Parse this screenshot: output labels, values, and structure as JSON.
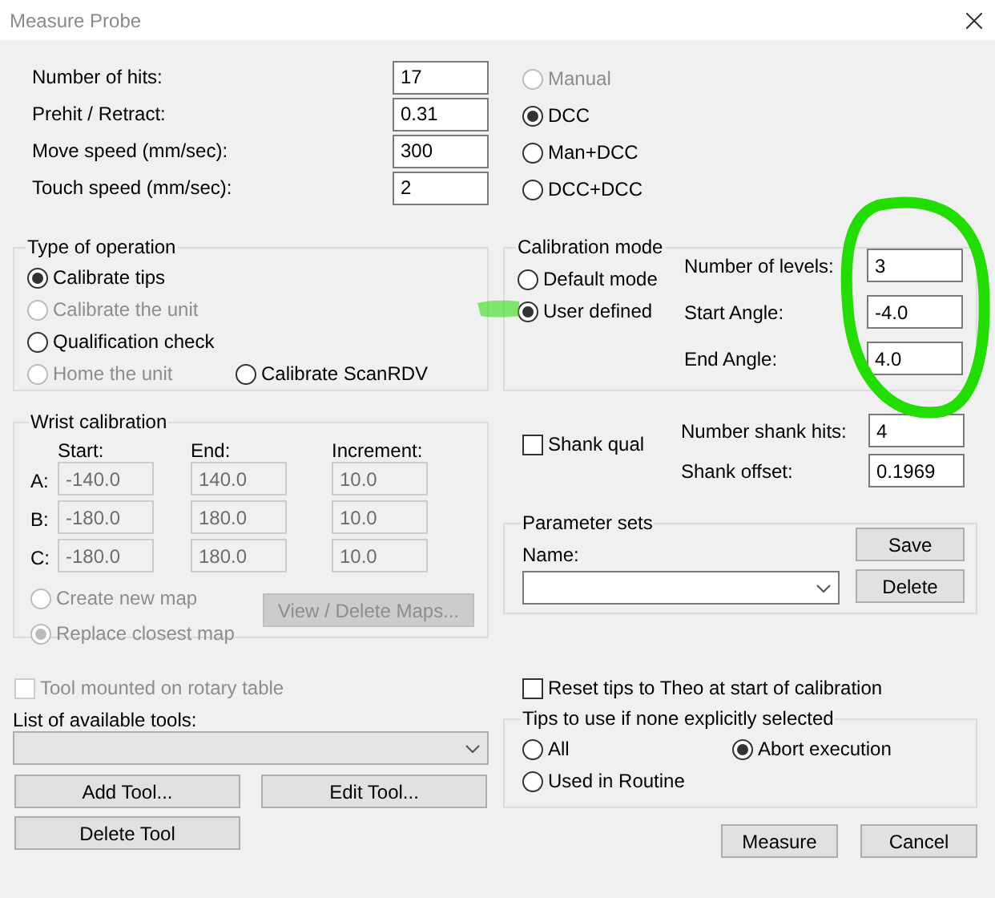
{
  "window": {
    "title": "Measure Probe"
  },
  "parameters": [
    {
      "label": "Number of hits:",
      "value": "17"
    },
    {
      "label": "Prehit / Retract:",
      "value": "0.31"
    },
    {
      "label": "Move speed (mm/sec):",
      "value": "300"
    },
    {
      "label": "Touch speed (mm/sec):",
      "value": "2"
    }
  ],
  "machine_mode": [
    {
      "label": "Manual",
      "selected": false,
      "disabled": true
    },
    {
      "label": "DCC",
      "selected": true,
      "disabled": false
    },
    {
      "label": "Man+DCC",
      "selected": false,
      "disabled": false
    },
    {
      "label": "DCC+DCC",
      "selected": false,
      "disabled": false
    }
  ],
  "type_of_operation": {
    "title": "Type of operation",
    "rows": [
      [
        {
          "label": "Calibrate tips",
          "selected": true,
          "disabled": false
        }
      ],
      [
        {
          "label": "Calibrate the unit",
          "selected": false,
          "disabled": true
        }
      ],
      [
        {
          "label": "Qualification check",
          "selected": false,
          "disabled": false
        }
      ],
      [
        {
          "label": "Home the unit",
          "selected": false,
          "disabled": true
        },
        {
          "label": "Calibrate ScanRDV",
          "selected": false,
          "disabled": false
        }
      ]
    ]
  },
  "calibration_mode": {
    "title": "Calibration mode",
    "options": [
      {
        "label": "Default mode",
        "selected": false,
        "disabled": false
      },
      {
        "label": "User defined",
        "selected": true,
        "disabled": false
      }
    ],
    "fields": [
      {
        "label": "Number of levels:",
        "value": "3"
      },
      {
        "label": "Start Angle:",
        "value": "-4.0"
      },
      {
        "label": "End Angle:",
        "value": "4.0"
      }
    ]
  },
  "wrist_calibration": {
    "title": "Wrist calibration",
    "disabled": true,
    "headers": [
      "Start:",
      "End:",
      "Increment:"
    ],
    "rows": [
      {
        "axis": "A:",
        "values": [
          "-140.0",
          "140.0",
          "10.0"
        ]
      },
      {
        "axis": "B:",
        "values": [
          "-180.0",
          "180.0",
          "10.0"
        ]
      },
      {
        "axis": "C:",
        "values": [
          "-180.0",
          "180.0",
          "10.0"
        ]
      }
    ],
    "map_options": [
      {
        "label": "Create new map",
        "selected": false,
        "disabled": true
      },
      {
        "label": "Replace closest map",
        "selected": true,
        "disabled": true
      }
    ],
    "button": "View / Delete Maps..."
  },
  "shank": {
    "checkbox": {
      "label": "Shank qual",
      "checked": false
    },
    "fields": [
      {
        "label": "Number shank hits:",
        "value": "4"
      },
      {
        "label": "Shank offset:",
        "value": "0.1969"
      }
    ]
  },
  "parameter_sets": {
    "title": "Parameter sets",
    "name_label": "Name:",
    "buttons": [
      "Save",
      "Delete"
    ]
  },
  "rotary_table": {
    "label": "Tool mounted on rotary table",
    "checked": false,
    "disabled": true
  },
  "reset_tips": {
    "label": "Reset tips to Theo at start of calibration",
    "checked": false,
    "disabled": false
  },
  "tools": {
    "label": "List of available tools:",
    "disabled": true,
    "buttons": [
      "Add Tool...",
      "Edit Tool...",
      "Delete Tool"
    ]
  },
  "tips_to_use": {
    "title": "Tips to use if none explicitly selected",
    "rows": [
      [
        {
          "label": "All",
          "selected": false,
          "disabled": false
        },
        {
          "label": "Abort execution",
          "selected": true,
          "disabled": false
        }
      ],
      [
        {
          "label": "Used in Routine",
          "selected": false,
          "disabled": false
        }
      ]
    ]
  },
  "buttons": [
    "Measure",
    "Cancel"
  ]
}
